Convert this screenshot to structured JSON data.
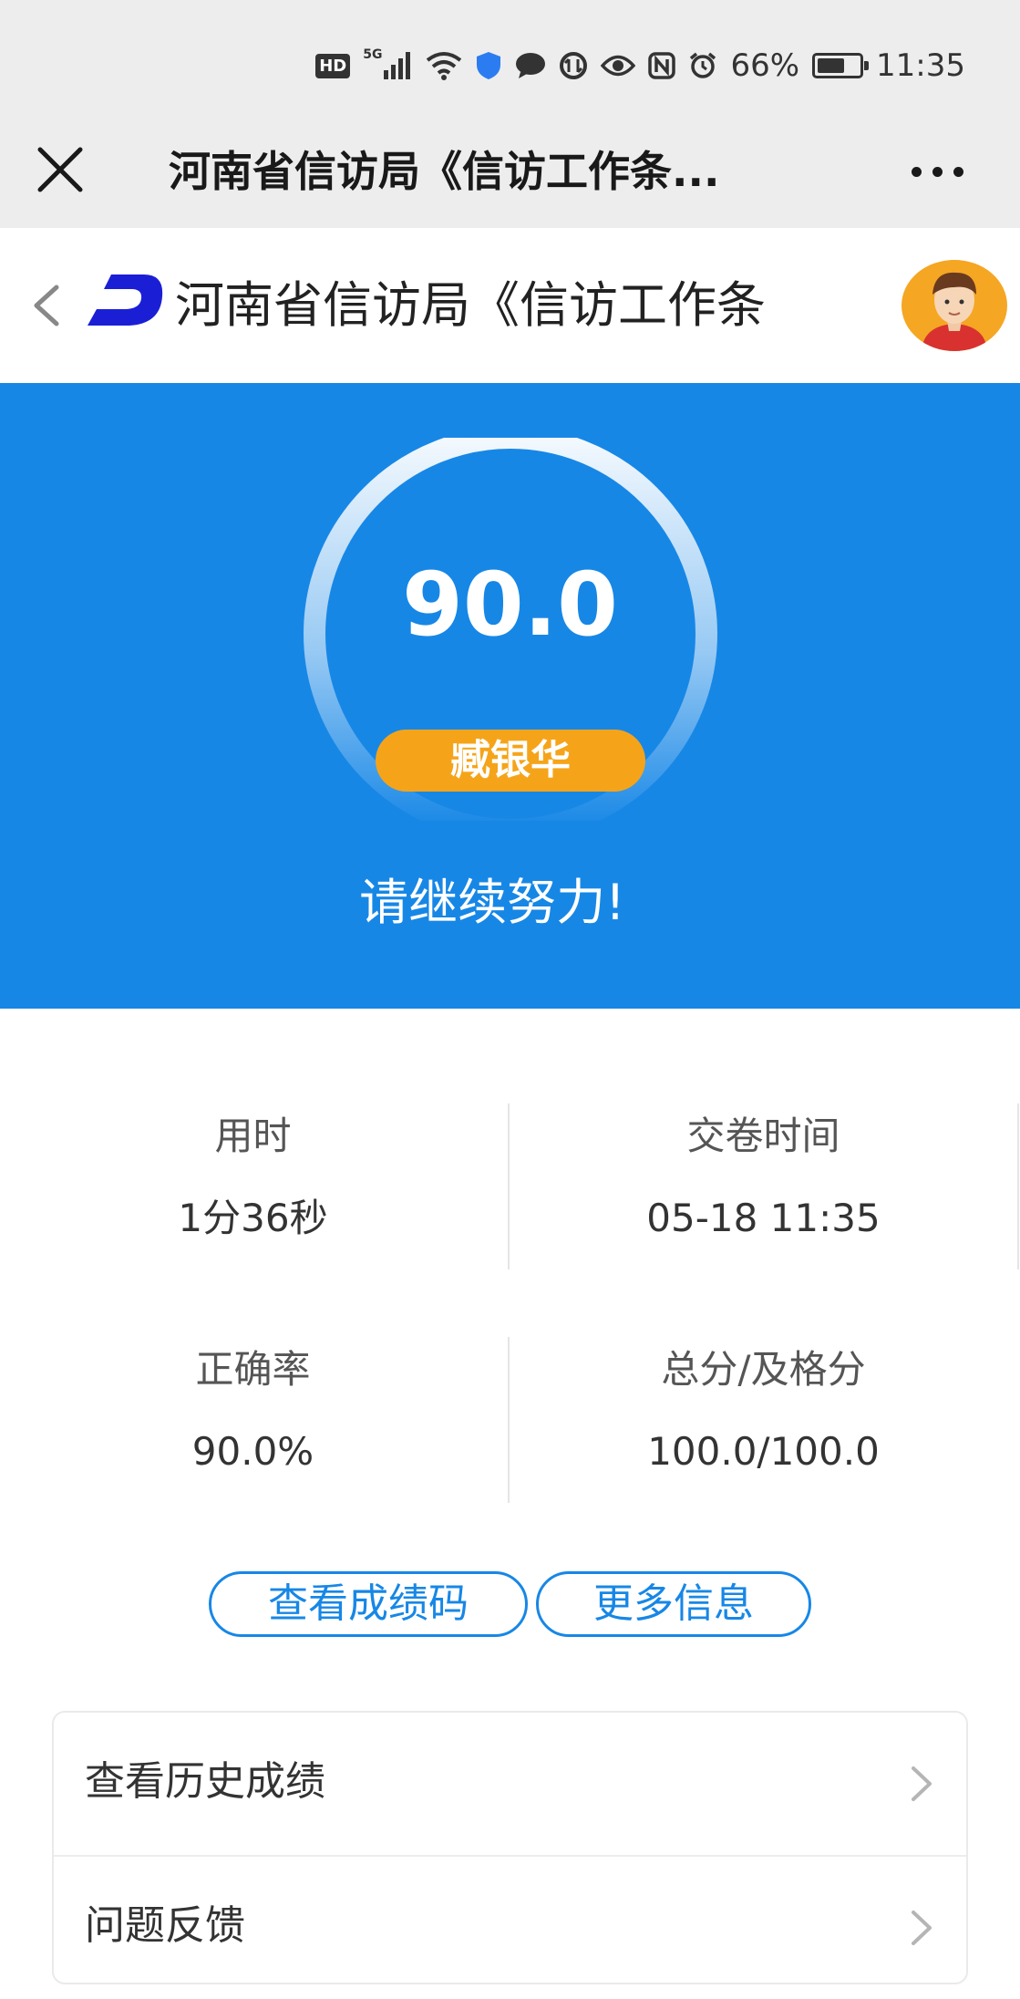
{
  "status_bar": {
    "hd": "HD",
    "network": "5G",
    "battery_level": "66%",
    "battery_fraction": 0.66,
    "time": "11:35",
    "icons": [
      "hd-icon",
      "signal-icon",
      "wifi-icon",
      "shield-icon",
      "chat-icon",
      "data-icon",
      "eye-icon",
      "nfc-icon",
      "alarm-icon",
      "battery-icon"
    ]
  },
  "wechat_bar": {
    "title": "河南省信访局《信访工作条...",
    "close_icon": "close-icon",
    "more_icon": "more-icon"
  },
  "app_header": {
    "title": "河南省信访局《信访工作条",
    "back_icon": "chevron-left-icon",
    "logo": "logo-icon",
    "avatar": "avatar"
  },
  "result": {
    "score": "90.0",
    "name": "臧银华",
    "message": "请继续努力!",
    "accent_color": "#1787e6",
    "badge_color": "#f5a41a"
  },
  "stats": [
    {
      "label": "用时",
      "value": "1分36秒"
    },
    {
      "label": "交卷时间",
      "value": "05-18 11:35"
    },
    {
      "label": "正确率",
      "value": "90.0%"
    },
    {
      "label": "总分/及格分",
      "value": "100.0/100.0"
    }
  ],
  "buttons": {
    "score_code": "查看成绩码",
    "more_info": "更多信息"
  },
  "menu": [
    {
      "label": "查看历史成绩"
    },
    {
      "label": "问题反馈"
    }
  ]
}
